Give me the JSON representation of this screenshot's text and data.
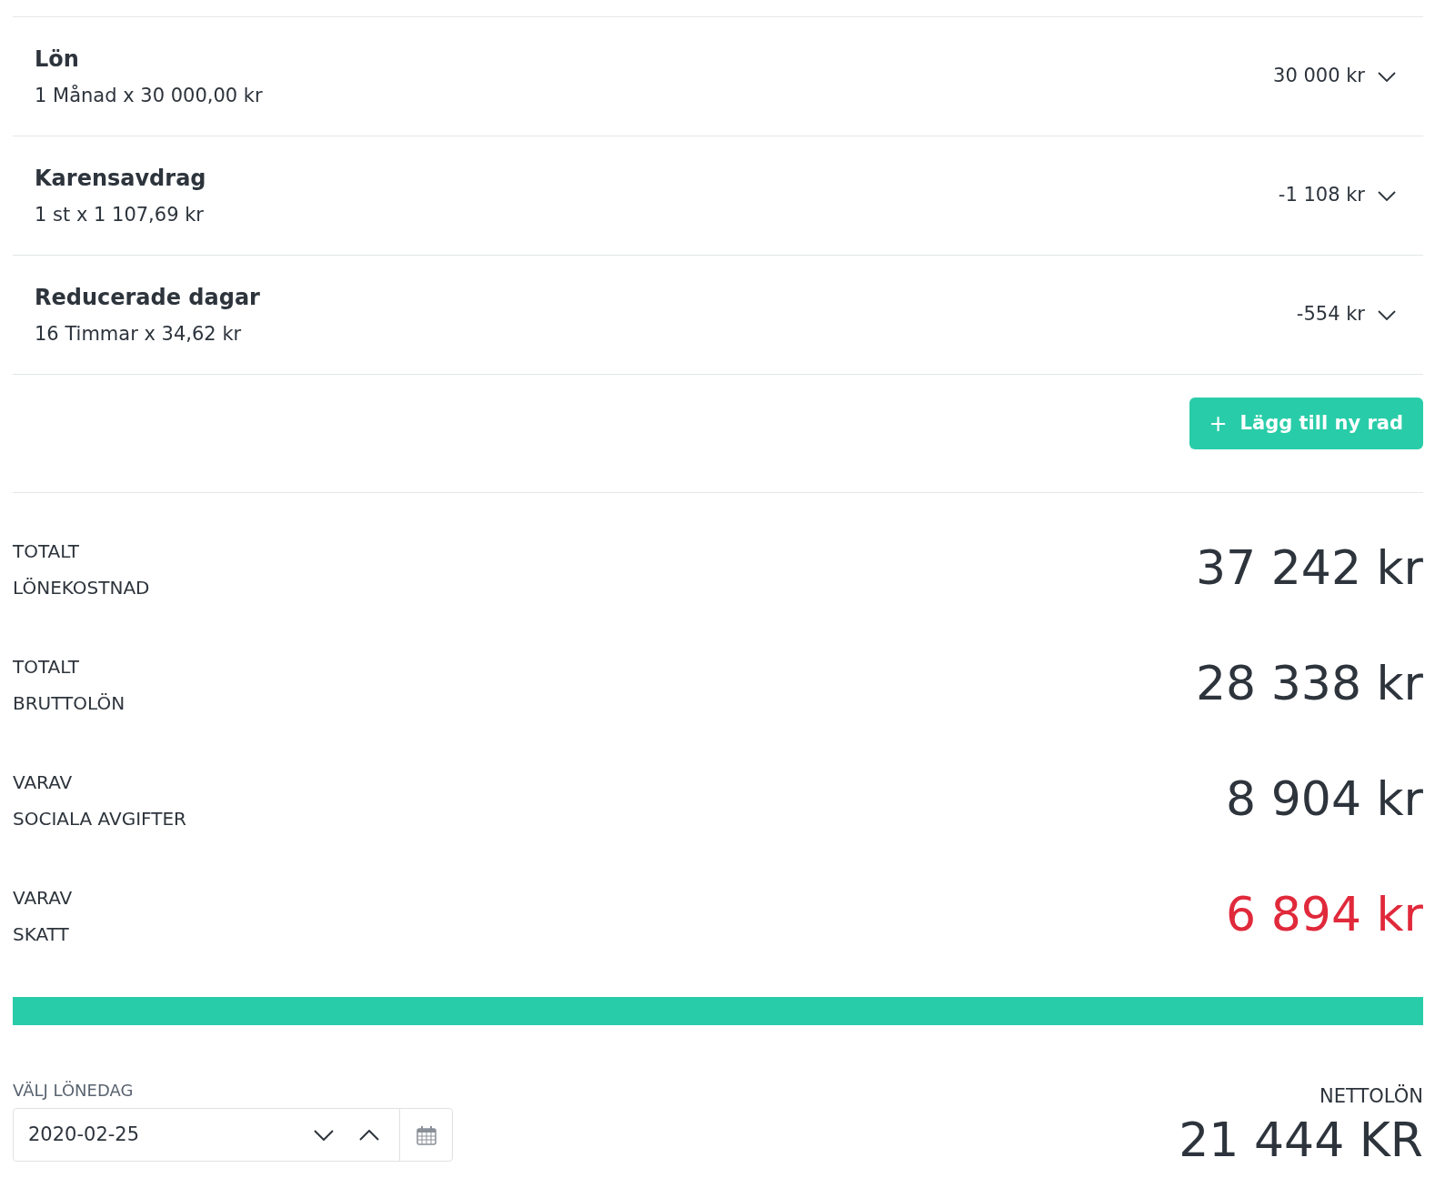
{
  "rows": [
    {
      "title": "Lön",
      "detail": "1 Månad x 30 000,00 kr",
      "amount": "30 000 kr"
    },
    {
      "title": "Karensavdrag",
      "detail": "1 st x 1 107,69 kr",
      "amount": "-1 108 kr"
    },
    {
      "title": "Reducerade dagar",
      "detail": "16 Timmar x 34,62 kr",
      "amount": "-554 kr"
    }
  ],
  "add_button": {
    "icon": "+",
    "label": "Lägg till ny rad"
  },
  "totals": [
    {
      "label_lines": [
        "TOTALT",
        "LÖNEKOSTNAD"
      ],
      "value": "37 242 kr",
      "color": "#2d343c"
    },
    {
      "label_lines": [
        "TOTALT",
        "BRUTTOLÖN"
      ],
      "value": "28 338 kr",
      "color": "#2d343c"
    },
    {
      "label_lines": [
        "VARAV",
        "SOCIALA AVGIFTER"
      ],
      "value": "8 904 kr",
      "color": "#2d343c"
    },
    {
      "label_lines": [
        "VARAV",
        "SKATT"
      ],
      "value": "6 894 kr",
      "color": "#e0293b"
    }
  ],
  "payday": {
    "label": "VÄLJ LÖNEDAG",
    "value": "2020-02-25"
  },
  "net": {
    "label": "NETTOLÖN",
    "value": "21 444 KR"
  }
}
